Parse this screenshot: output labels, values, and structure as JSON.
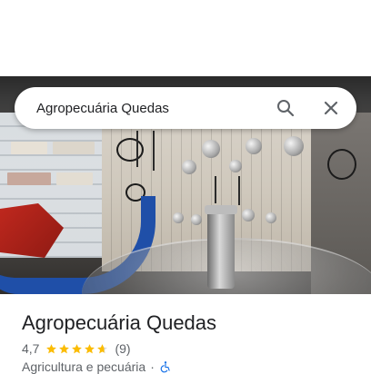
{
  "search": {
    "query": "Agropecuária Quedas",
    "search_icon": "search-icon",
    "close_icon": "close-icon"
  },
  "photo": {
    "subject": "store-interior-photo"
  },
  "place": {
    "name": "Agropecuária Quedas",
    "rating": "4,7",
    "rating_value": 4.7,
    "stars_max": 5,
    "review_count": "(9)",
    "category": "Agricultura e pecuária",
    "separator": "·",
    "accessibility_icon": "wheelchair-accessible-icon"
  },
  "colors": {
    "star": "#fbbc04",
    "accessibility": "#1a73e8",
    "text_primary": "#202124",
    "text_secondary": "#5f6368"
  }
}
